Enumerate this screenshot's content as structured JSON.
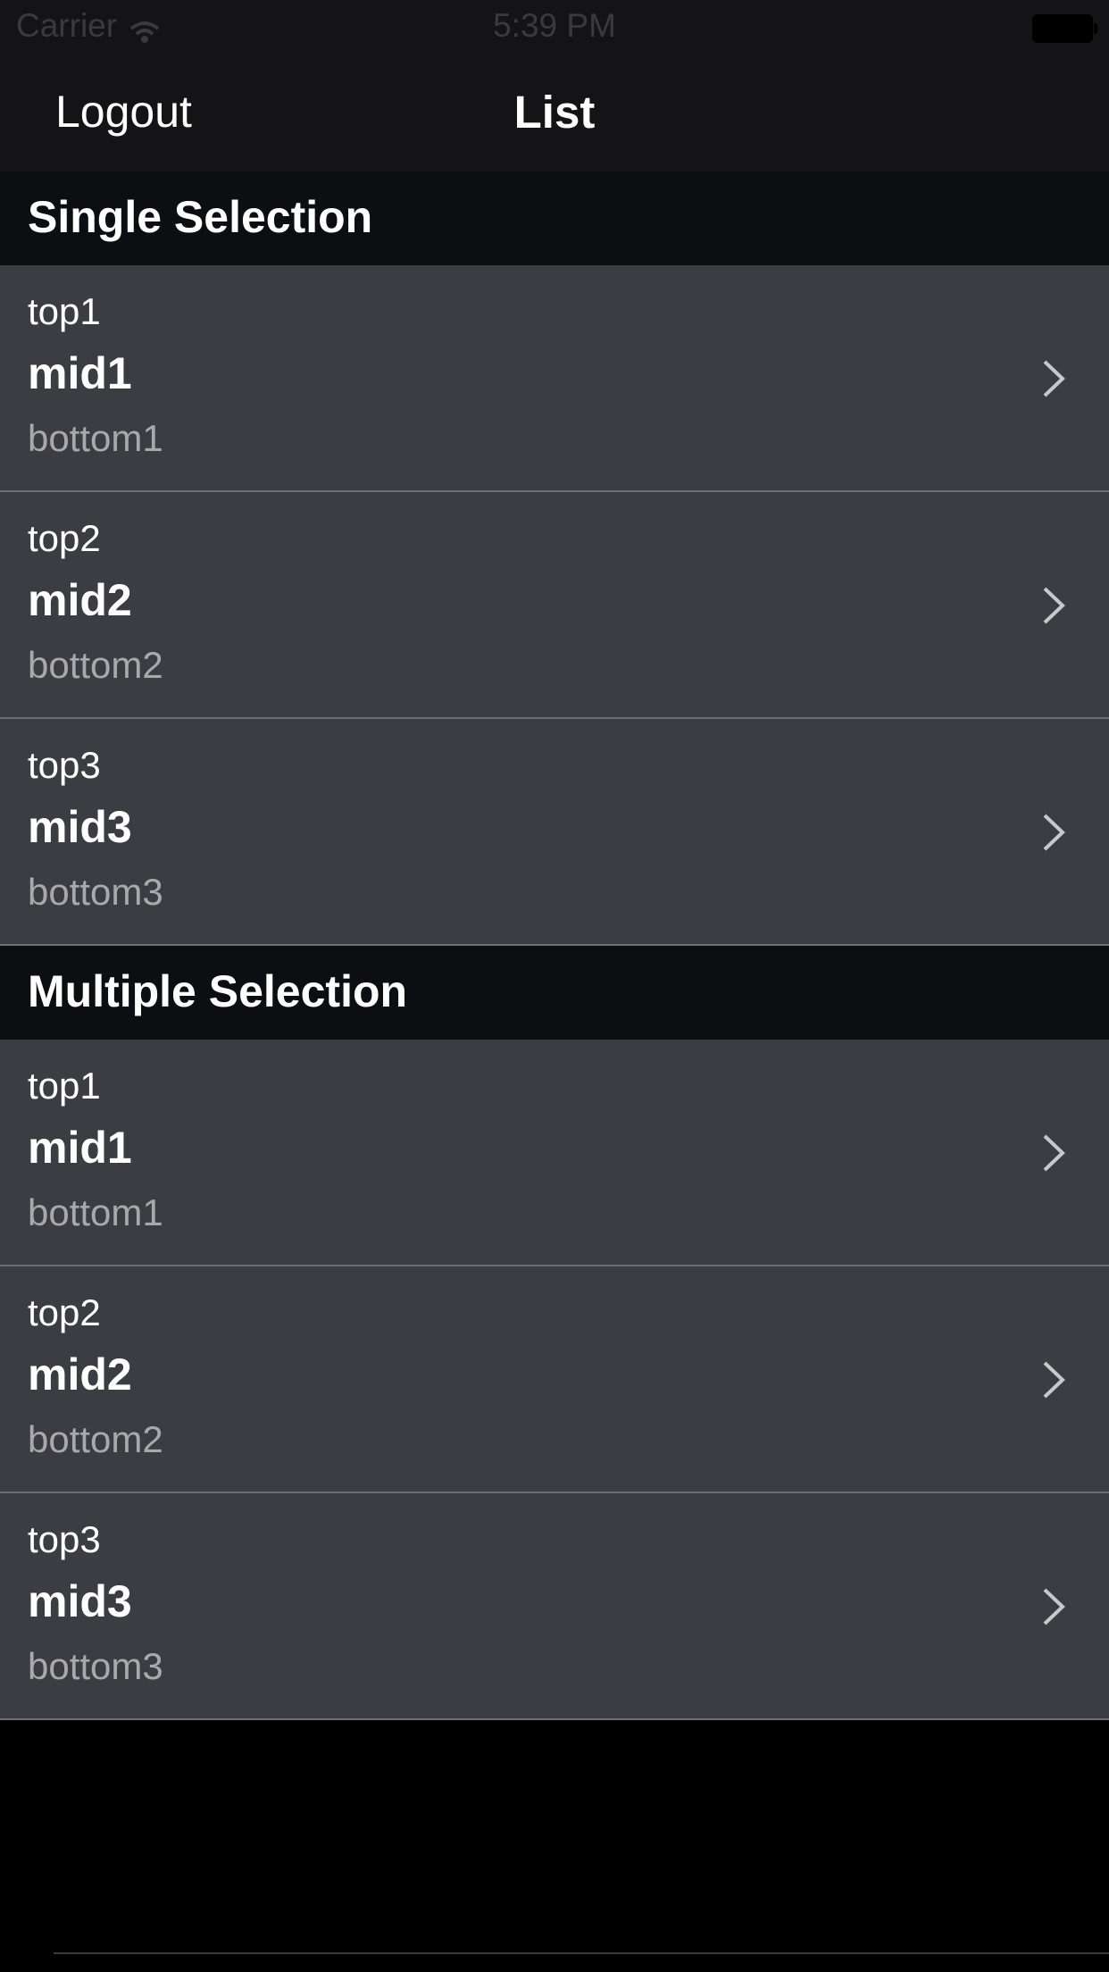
{
  "status_bar": {
    "carrier": "Carrier",
    "time": "5:39 PM"
  },
  "nav": {
    "left_button": "Logout",
    "title": "List"
  },
  "sections": [
    {
      "title": "Single Selection",
      "rows": [
        {
          "top": "top1",
          "mid": "mid1",
          "bottom": "bottom1"
        },
        {
          "top": "top2",
          "mid": "mid2",
          "bottom": "bottom2"
        },
        {
          "top": "top3",
          "mid": "mid3",
          "bottom": "bottom3"
        }
      ]
    },
    {
      "title": "Multiple Selection",
      "rows": [
        {
          "top": "top1",
          "mid": "mid1",
          "bottom": "bottom1"
        },
        {
          "top": "top2",
          "mid": "mid2",
          "bottom": "bottom2"
        },
        {
          "top": "top3",
          "mid": "mid3",
          "bottom": "bottom3"
        }
      ]
    }
  ],
  "colors": {
    "nav_background": "#141416",
    "section_header_background": "#0d0e12",
    "row_background": "#3c3d42",
    "row_separator": "#6e6f73",
    "secondary_text": "#a9a9ad",
    "page_background": "#000000"
  },
  "icons": {
    "row_accessory": "chevron-right-icon",
    "status_wifi": "wifi-icon",
    "status_battery": "battery-icon"
  }
}
